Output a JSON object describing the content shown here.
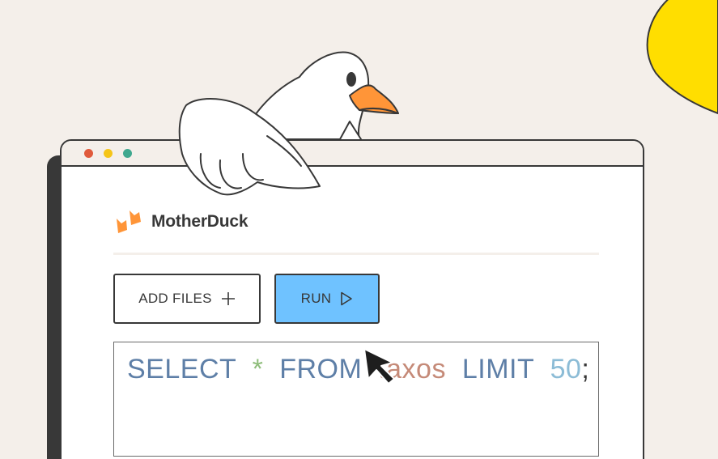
{
  "colors": {
    "background": "#f4efea",
    "outline": "#383838",
    "sun": "#ffde00",
    "run_button": "#6fc2ff",
    "dot_red": "#e05a3c",
    "dot_yellow": "#f5c518",
    "dot_green": "#3fa88f",
    "logo_orange": "#ff9538",
    "sql_keyword": "#5e7fa7",
    "sql_star": "#8ebd7a",
    "sql_table": "#c58a78",
    "sql_number": "#8cbcd6"
  },
  "app": {
    "logo_text": "MotherDuck",
    "logo_icon": "duck-feet-icon"
  },
  "toolbar": {
    "add_files_label": "ADD FILES",
    "add_files_icon": "plus-icon",
    "run_label": "RUN",
    "run_icon": "play-icon"
  },
  "editor": {
    "sql_tokens": [
      {
        "text": "SELECT",
        "kind": "keyword"
      },
      {
        "text": "*",
        "kind": "star"
      },
      {
        "text": "FROM",
        "kind": "keyword"
      },
      {
        "text": "taxos",
        "kind": "table"
      },
      {
        "text": "LIMIT",
        "kind": "keyword"
      },
      {
        "text": "50",
        "kind": "number"
      },
      {
        "text": ";",
        "kind": "punct"
      }
    ]
  },
  "decor": {
    "mascot": "duck-mascot",
    "pointer": "mouse-pointer-icon"
  }
}
